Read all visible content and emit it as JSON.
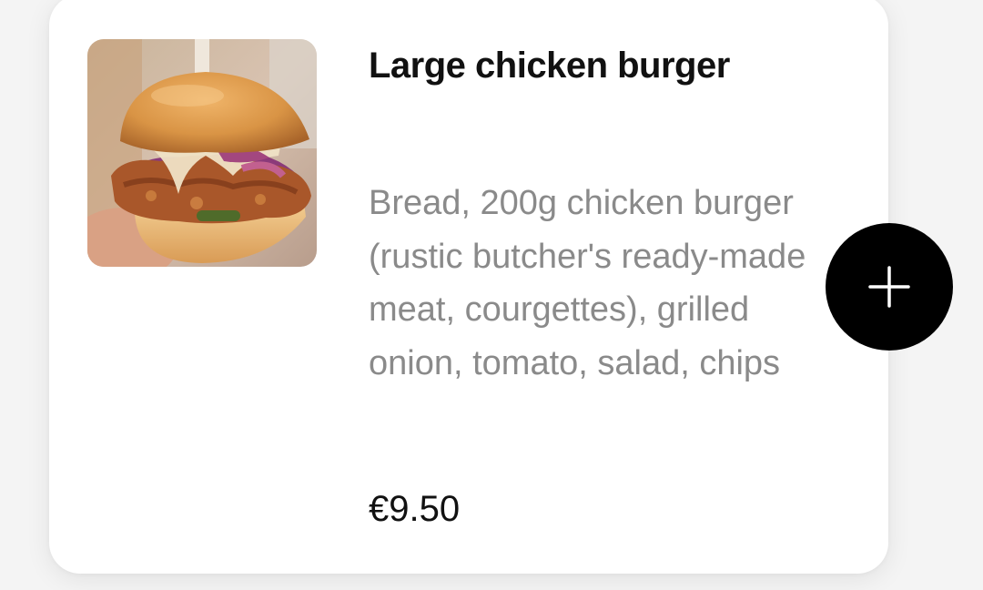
{
  "product": {
    "title": "Large chicken burger",
    "description": "Bread, 200g chicken burger (rustic butcher's ready-made meat, courgettes), grilled onion, tomato, salad, chips",
    "price": "€9.50",
    "image_icon": "burger-photo",
    "add_icon": "plus-icon"
  },
  "colors": {
    "card_bg": "#ffffff",
    "title": "#111111",
    "description": "#8a8a8a",
    "add_button_bg": "#000000",
    "add_button_icon": "#ffffff"
  }
}
